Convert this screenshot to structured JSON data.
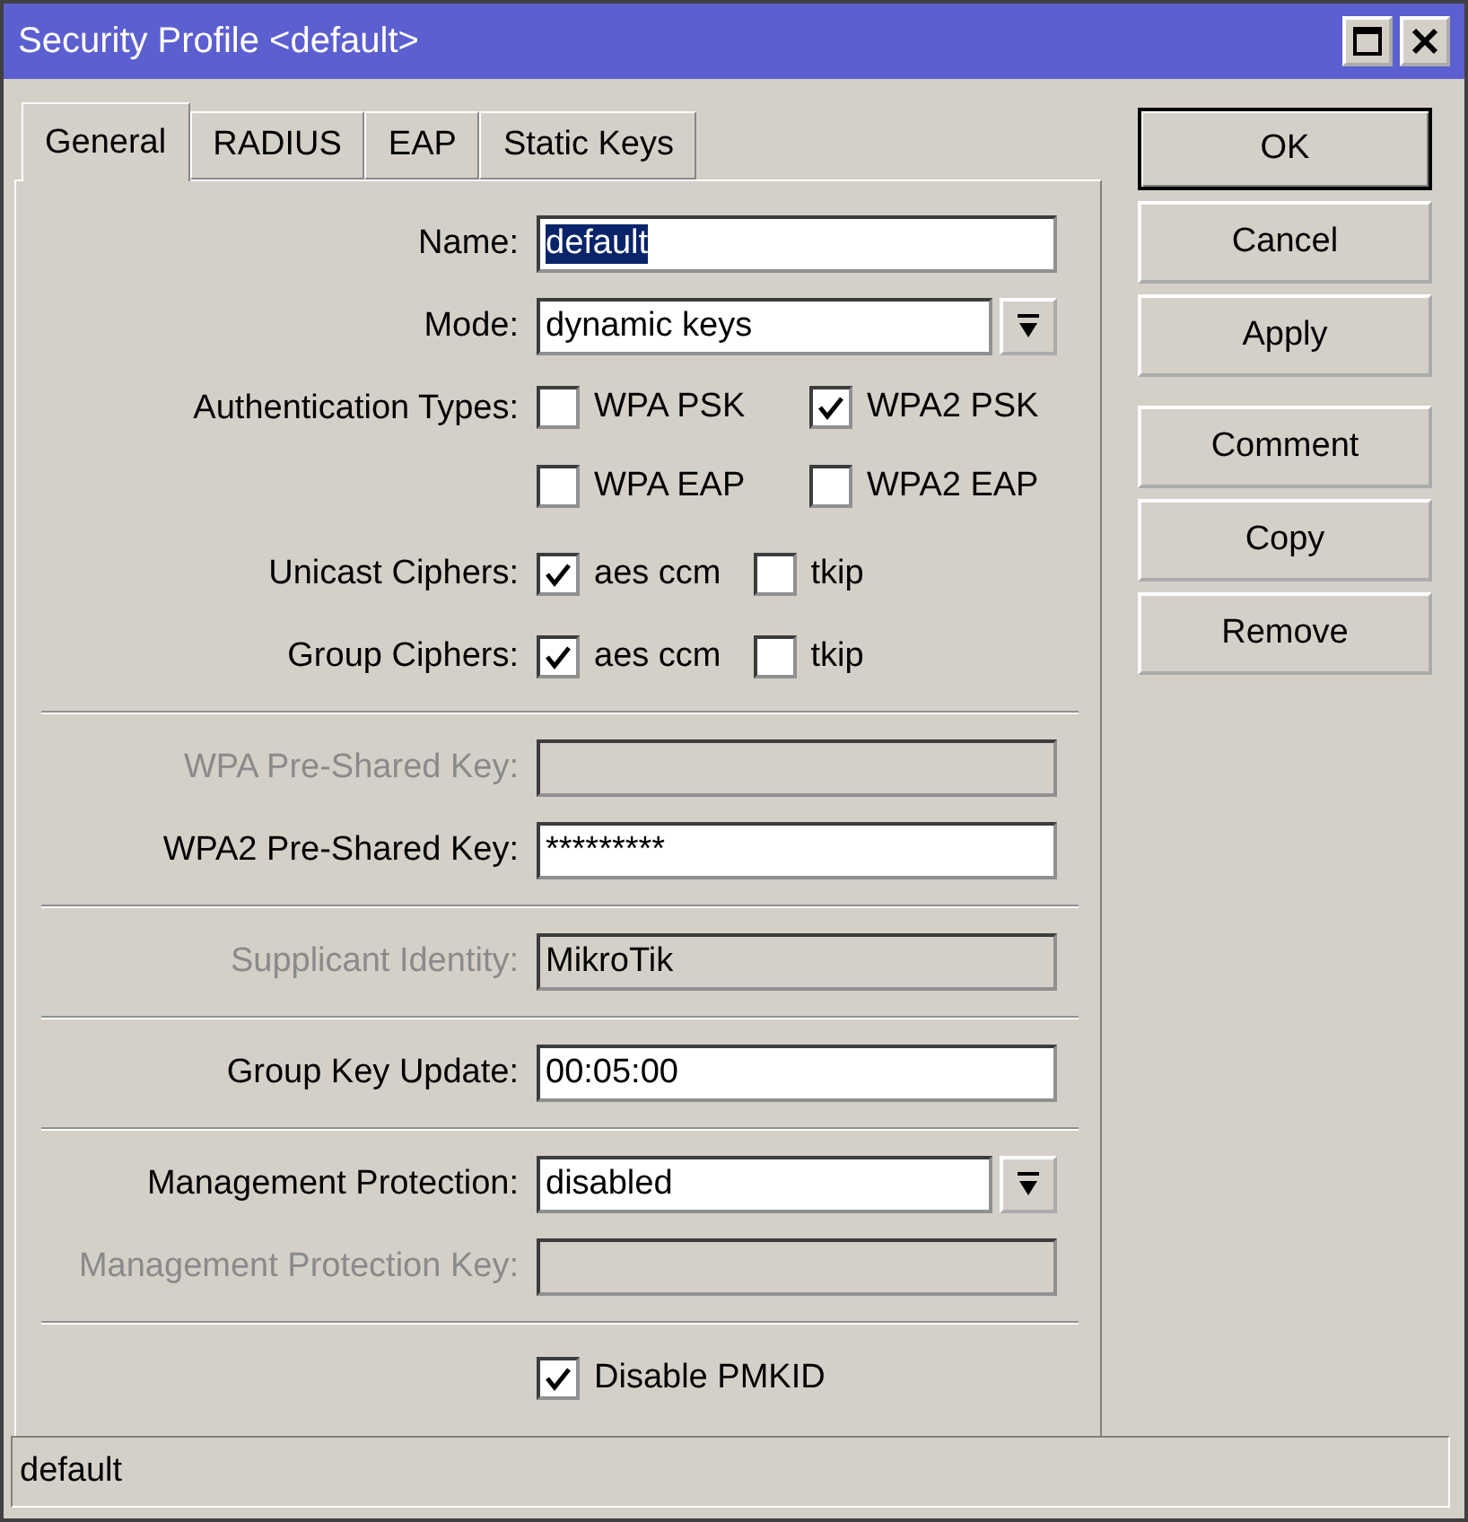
{
  "window": {
    "title": "Security Profile <default>"
  },
  "tabs": [
    {
      "label": "General",
      "selected": true
    },
    {
      "label": "RADIUS",
      "selected": false
    },
    {
      "label": "EAP",
      "selected": false
    },
    {
      "label": "Static Keys",
      "selected": false
    }
  ],
  "form": {
    "rows": [
      {
        "kind": "text",
        "label": "Name:",
        "value": "default",
        "highlighted": true,
        "disabled": false
      },
      {
        "kind": "select",
        "label": "Mode:",
        "value": "dynamic keys",
        "disabled": false
      },
      {
        "kind": "check_grid",
        "label": "Authentication Types:",
        "disabled": false,
        "options": [
          {
            "label": "WPA PSK",
            "checked": false
          },
          {
            "label": "WPA2 PSK",
            "checked": true
          },
          {
            "label": "WPA EAP",
            "checked": false
          },
          {
            "label": "WPA2 EAP",
            "checked": false
          }
        ]
      },
      {
        "kind": "check_row",
        "label": "Unicast Ciphers:",
        "disabled": false,
        "options": [
          {
            "label": "aes ccm",
            "checked": true
          },
          {
            "label": "tkip",
            "checked": false
          }
        ]
      },
      {
        "kind": "check_row",
        "label": "Group Ciphers:",
        "disabled": false,
        "options": [
          {
            "label": "aes ccm",
            "checked": true
          },
          {
            "label": "tkip",
            "checked": false
          }
        ]
      },
      {
        "kind": "divider"
      },
      {
        "kind": "text",
        "label": "WPA Pre-Shared Key:",
        "disabled": true
      },
      {
        "kind": "text",
        "label": "WPA2 Pre-Shared Key:",
        "value": "*********",
        "highlighted": false,
        "disabled": false
      },
      {
        "kind": "divider"
      },
      {
        "kind": "text",
        "label": "Supplicant Identity:",
        "value": "MikroTik",
        "highlighted": false,
        "disabled": true
      },
      {
        "kind": "divider"
      },
      {
        "kind": "text",
        "label": "Group Key Update:",
        "value": "00:05:00",
        "highlighted": false,
        "disabled": false
      },
      {
        "kind": "divider"
      },
      {
        "kind": "select",
        "label": "Management Protection:",
        "value": "disabled",
        "disabled": false
      },
      {
        "kind": "text",
        "label": "Management Protection Key:",
        "disabled": true
      },
      {
        "kind": "divider"
      },
      {
        "kind": "checkbox",
        "label": "Disable PMKID",
        "checked": true
      }
    ]
  },
  "button_groups": [
    [
      "OK",
      "Cancel",
      "Apply"
    ],
    [
      "Comment",
      "Copy",
      "Remove"
    ]
  ],
  "status_bar": "default"
}
